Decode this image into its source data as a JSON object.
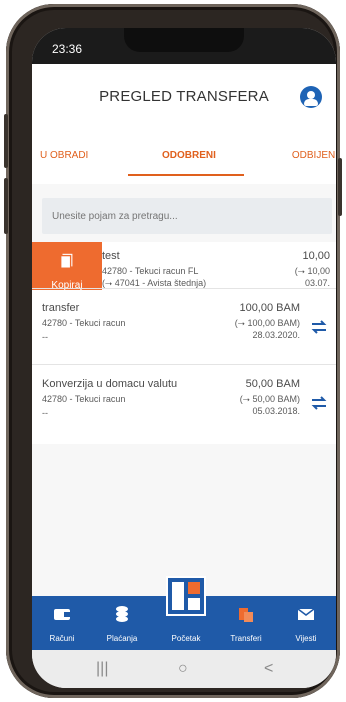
{
  "status": {
    "time": "23:36"
  },
  "header": {
    "title": "PREGLED TRANSFERA"
  },
  "tabs": {
    "left": "U OBRADI",
    "middle": "ODOBRENI",
    "right": "ODBIJENI"
  },
  "search": {
    "placeholder": "Unesite pojam za pretragu..."
  },
  "rows": [
    {
      "name": "test",
      "line1": "42780 - Tekuci racun FL",
      "line2": "(⭢ 47041 - Avista štednja)",
      "amount": "10,00",
      "amount2": "(⭢ 10,00",
      "date": "03.07.",
      "tail": ""
    },
    {
      "name": "transfer",
      "line1": "42780 - Tekuci racun",
      "line2": "",
      "amount": "100,00 BAM",
      "amount2": "(⭢ 100,00 BAM)",
      "date": "28.03.2020.",
      "tail": "--"
    },
    {
      "name": "Konverzija u domacu valutu",
      "line1": "42780 - Tekuci racun",
      "line2": "",
      "amount": "50,00 BAM",
      "amount2": "(⭢ 50,00 BAM)",
      "date": "05.03.2018.",
      "tail": "--"
    }
  ],
  "copy": {
    "label": "Kopiraj"
  },
  "bottom_nav": {
    "accounts": "Računi",
    "payments": "Plaćanja",
    "home": "Početak",
    "transfers": "Transferi",
    "news": "Vijesti"
  },
  "system_nav": {
    "recents": "|||",
    "home": "○",
    "back": "<"
  },
  "colors": {
    "brand": "#1f5aa8",
    "accent": "#ee6b2f"
  }
}
